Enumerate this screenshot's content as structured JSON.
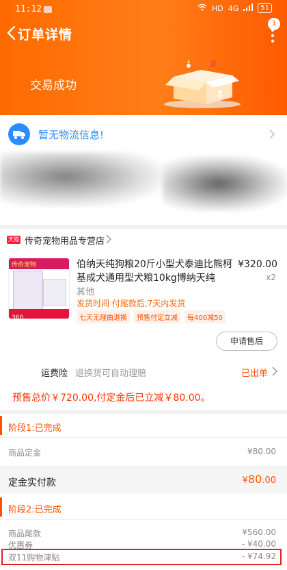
{
  "status_bar": {
    "time": "11:12",
    "network": "HD",
    "signal": "4G",
    "battery": "51"
  },
  "nav": {
    "title": "订单详情",
    "badge_count": "1"
  },
  "order": {
    "status": "交易成功"
  },
  "logistics": {
    "text": "暂无物流信息!"
  },
  "store": {
    "tag": "天猫",
    "name": "传奇宠物用品专营店"
  },
  "product": {
    "title": "伯纳天纯狗粮20斤小型犬泰迪比熊柯基成犬通用型犬粮10kg博纳天纯",
    "price": "¥320.00",
    "qty": "x2",
    "spec": "其他",
    "ship_info": "发货时间  付尾款后,7天内发货",
    "tags": [
      "七天无理由退换",
      "预售付定立减",
      "每400减50"
    ],
    "image_text": {
      "top": "传奇宠物",
      "badge": "360"
    }
  },
  "aftersale_label": "申请售后",
  "insurance": {
    "label": "运费险",
    "desc": "退换货可自动理赔",
    "status": "已出单"
  },
  "presale_note": "预售总价￥720.00,付定金后已立减￥80.00。",
  "stage1": {
    "title": "阶段1:已完成",
    "rows": [
      {
        "label": "商品定金",
        "value": "¥80.00"
      }
    ],
    "paid": {
      "label": "定金实付款",
      "symbol": "¥",
      "int": "80",
      "dec": ".00"
    }
  },
  "stage2": {
    "title": "阶段2:已完成",
    "rows": [
      {
        "label": "商品尾款",
        "value": "¥560.00"
      },
      {
        "label": "优惠券",
        "value": "- ¥40.00"
      },
      {
        "label": "双11购物津贴",
        "value": "- ¥74.92"
      }
    ]
  },
  "colors": {
    "header": "#ff6a00",
    "accent": "#ff5000",
    "logistics": "#2a8cff"
  },
  "icons": [
    "back-arrow-icon",
    "more-icon",
    "truck-icon",
    "chevron-right-icon",
    "box-illustration"
  ]
}
